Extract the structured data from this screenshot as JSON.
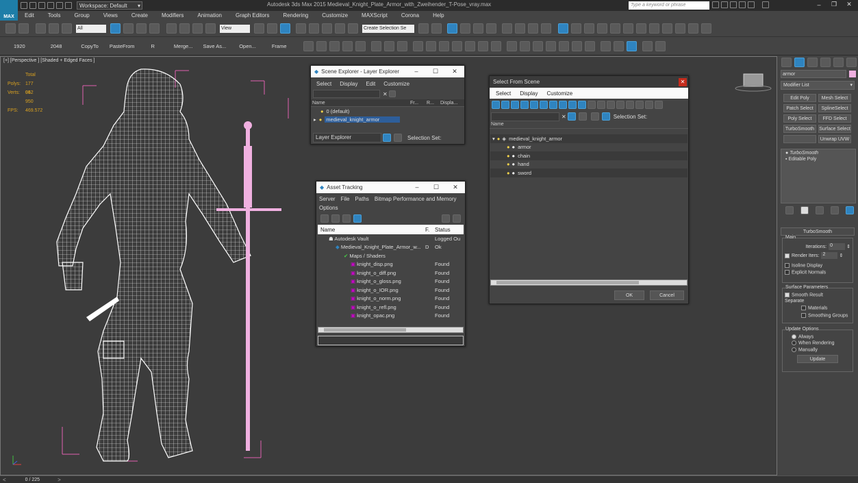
{
  "titlebar": {
    "workspace_label": "Workspace: Default",
    "app_title": "Autodesk 3ds Max 2015     Medieval_Knight_Plate_Armor_with_Zweihender_T-Pose_vray.max",
    "search_placeholder": "Type a keyword or phrase"
  },
  "logo": "MAX",
  "menu": [
    "Edit",
    "Tools",
    "Group",
    "Views",
    "Create",
    "Modifiers",
    "Animation",
    "Graph Editors",
    "Rendering",
    "Customize",
    "MAXScript",
    "Corona",
    "Help"
  ],
  "toolbar": {
    "selection_filter": "All",
    "ref_coord": "View",
    "named_selection": "Create Selection Se"
  },
  "toolbar2": [
    "1920",
    "2048",
    "CopyTo",
    "PasteFrom",
    "R",
    "Merge...",
    "Save As...",
    "Open...",
    "Frame"
  ],
  "viewport": {
    "label": "[+] [Perspective ] [Shaded + Edged Faces ]",
    "stats": {
      "total_label": "Total",
      "polys_label": "Polys:",
      "polys_value": "177 052",
      "verts_label": "Verts:",
      "verts_value": "94 950",
      "fps_label": "FPS:",
      "fps_value": "469.572"
    }
  },
  "scene_explorer": {
    "title": "Scene Explorer - Layer Explorer",
    "menu": [
      "Select",
      "Display",
      "Edit",
      "Customize"
    ],
    "columns": [
      "Name",
      "Fr...",
      "R...",
      "Displa..."
    ],
    "rows": [
      "0 (default)",
      "medieval_knight_armor"
    ],
    "footer_dropdown": "Layer Explorer",
    "footer_label": "Selection Set:"
  },
  "asset_tracking": {
    "title": "Asset Tracking",
    "menu": [
      "Server",
      "File",
      "Paths",
      "Bitmap Performance and Memory"
    ],
    "menu2": "Options",
    "columns": [
      "Name",
      "F.",
      "Status"
    ],
    "rows": [
      {
        "name": "Autodesk Vault",
        "f": "",
        "status": "Logged Ou"
      },
      {
        "name": "Medieval_Knight_Plate_Armor_w...",
        "f": "D",
        "status": "Ok"
      },
      {
        "name": "Maps / Shaders",
        "f": "",
        "status": ""
      },
      {
        "name": "knight_disp.png",
        "f": "",
        "status": "Found"
      },
      {
        "name": "knight_o_diff.png",
        "f": "",
        "status": "Found"
      },
      {
        "name": "knight_o_gloss.png",
        "f": "",
        "status": "Found"
      },
      {
        "name": "knight_o_IOR.png",
        "f": "",
        "status": "Found"
      },
      {
        "name": "knight_o_norm.png",
        "f": "",
        "status": "Found"
      },
      {
        "name": "knight_o_refl.png",
        "f": "",
        "status": "Found"
      },
      {
        "name": "knight_opac.png",
        "f": "",
        "status": "Found"
      }
    ]
  },
  "select_from_scene": {
    "title": "Select From Scene",
    "menu": [
      "Select",
      "Display",
      "Customize"
    ],
    "selection_set_label": "Selection Set:",
    "column": "Name",
    "root": "medieval_knight_armor",
    "children": [
      "armor",
      "chain",
      "hand",
      "sword"
    ],
    "ok": "OK",
    "cancel": "Cancel"
  },
  "command_panel": {
    "object_name": "armor",
    "modifier_list": "Modifier List",
    "buttons": [
      "Edit Poly",
      "Mesh Select",
      "Patch Select",
      "SplineSelect",
      "Poly Select",
      "FFD Select",
      "TurboSmooth",
      "Surface Select",
      "",
      "Unwrap UVW"
    ],
    "stack": [
      "TurboSmooth",
      "Editable Poly"
    ],
    "rollout_title": "TurboSmooth",
    "main_label": "Main",
    "iterations_label": "Iterations:",
    "iterations_value": "0",
    "render_iters_label": "Render Iters:",
    "render_iters_value": "2",
    "isoline": "Isoline Display",
    "explicit_normals": "Explicit Normals",
    "surface_params": "Surface Parameters",
    "smooth_result": "Smooth Result",
    "separate": "Separate",
    "materials": "Materials",
    "smoothing_groups": "Smoothing Groups",
    "update_options": "Update Options",
    "always": "Always",
    "when_rendering": "When Rendering",
    "manually": "Manually",
    "update": "Update"
  },
  "statusbar": {
    "frame": "0 / 225"
  },
  "colors": {
    "accent": "#2f84c0",
    "wire": "#ffffff",
    "sword": "#f0b0e0",
    "bbox": "#e060b0",
    "stats": "#d8a020"
  }
}
